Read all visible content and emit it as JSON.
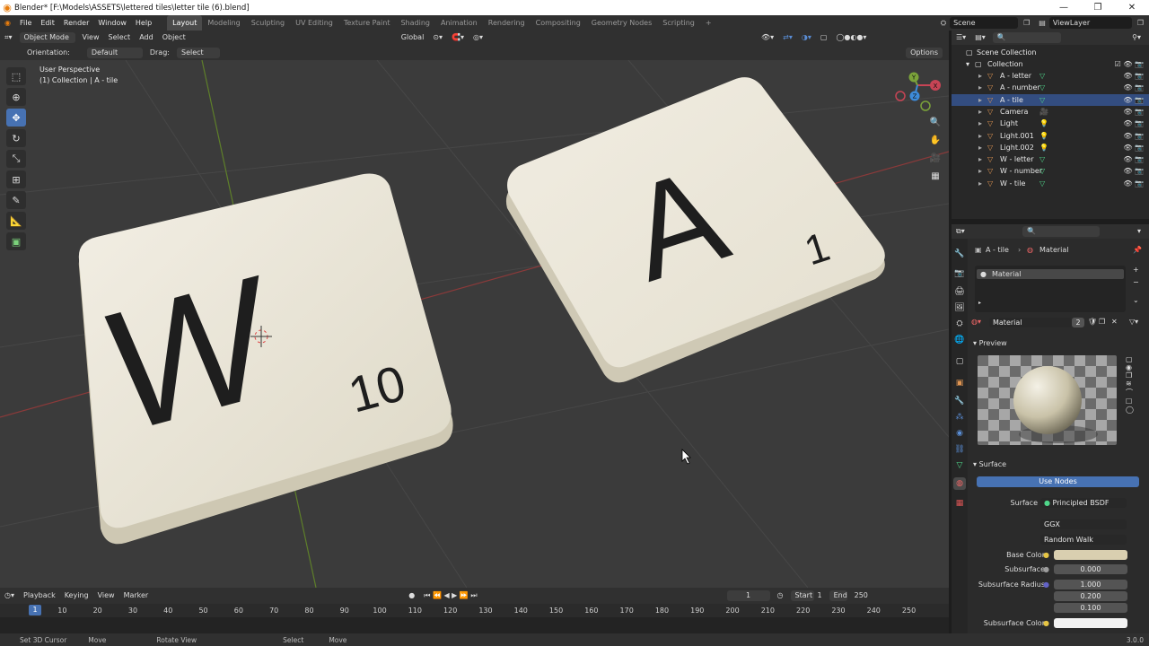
{
  "window": {
    "title": "Blender* [F:\\Models\\ASSETS\\lettered tiles\\letter tile (6).blend]",
    "controls": [
      "—",
      "❐",
      "✕"
    ]
  },
  "menubar": {
    "menus": [
      "File",
      "Edit",
      "Render",
      "Window",
      "Help"
    ],
    "workspaces": [
      "Layout",
      "Modeling",
      "Sculpting",
      "UV Editing",
      "Texture Paint",
      "Shading",
      "Animation",
      "Rendering",
      "Compositing",
      "Geometry Nodes",
      "Scripting"
    ],
    "active_workspace": "Layout",
    "add_tab": "+",
    "scene": "Scene",
    "view_layer": "ViewLayer"
  },
  "viewport_header": {
    "mode": "Object Mode",
    "menus": [
      "View",
      "Select",
      "Add",
      "Object"
    ],
    "transform": "Global"
  },
  "tool_header": {
    "orientation_label": "Orientation:",
    "orientation": "Default",
    "drag_label": "Drag:",
    "drag": "Select Box",
    "options": "Options"
  },
  "viewport": {
    "perspective": "User Perspective",
    "collection": "(1) Collection | A - tile",
    "tile_w": {
      "letter": "W",
      "number": "10"
    },
    "tile_a": {
      "letter": "A",
      "number": "1"
    },
    "gizmo": {
      "x": "X",
      "y": "Y",
      "z": "Z"
    }
  },
  "toolbar": {
    "tools": [
      "select-box-icon",
      "cursor-icon",
      "move-icon",
      "rotate-icon",
      "scale-icon",
      "transform-icon",
      "annotate-icon",
      "measure-icon",
      "add-cube-icon"
    ],
    "active": "move-icon"
  },
  "timeline": {
    "menus": [
      "Playback",
      "Keying",
      "View",
      "Marker"
    ],
    "current_frame": "1",
    "start_label": "Start",
    "start": "1",
    "end_label": "End",
    "end": "250",
    "ticks": [
      "10",
      "20",
      "30",
      "40",
      "50",
      "60",
      "70",
      "80",
      "90",
      "100",
      "110",
      "120",
      "130",
      "140",
      "150",
      "160",
      "170",
      "180",
      "190",
      "200",
      "210",
      "220",
      "230",
      "240",
      "250"
    ]
  },
  "statusbar": {
    "items": [
      "Set 3D Cursor",
      "Move",
      "Rotate View",
      "Select",
      "Move"
    ],
    "version": "3.0.0"
  },
  "outliner": {
    "root": "Scene Collection",
    "collection": "Collection",
    "items": [
      {
        "name": "A - letter",
        "kind": "mesh",
        "icon_color": "#e09552",
        "data_color": "#4fd68a",
        "selected": false
      },
      {
        "name": "A - number",
        "kind": "mesh",
        "icon_color": "#e09552",
        "data_color": "#4fd68a",
        "selected": false
      },
      {
        "name": "A - tile",
        "kind": "mesh",
        "icon_color": "#e09552",
        "data_color": "#4fd68a",
        "selected": true
      },
      {
        "name": "Camera",
        "kind": "camera",
        "icon_color": "#e09552",
        "data_color": "#4fd68a",
        "selected": false
      },
      {
        "name": "Light",
        "kind": "light",
        "icon_color": "#e09552",
        "data_color": "#4fd68a",
        "selected": false
      },
      {
        "name": "Light.001",
        "kind": "light",
        "icon_color": "#e09552",
        "data_color": "#4fd68a",
        "selected": false
      },
      {
        "name": "Light.002",
        "kind": "light",
        "icon_color": "#e09552",
        "data_color": "#4fd68a",
        "selected": false
      },
      {
        "name": "W - letter",
        "kind": "mesh",
        "icon_color": "#e09552",
        "data_color": "#4fd68a",
        "selected": false
      },
      {
        "name": "W - number",
        "kind": "mesh",
        "icon_color": "#e09552",
        "data_color": "#4fd68a",
        "selected": false
      },
      {
        "name": "W - tile",
        "kind": "mesh",
        "icon_color": "#e09552",
        "data_color": "#4fd68a",
        "selected": false
      }
    ]
  },
  "properties": {
    "breadcrumb": {
      "object": "A - tile",
      "data": "Material"
    },
    "slot": "Material",
    "material_name": "Material",
    "users": "2",
    "preview_label": "Preview",
    "surface_label": "Surface",
    "use_nodes": "Use Nodes",
    "surface_field_label": "Surface",
    "surface_shader": "Principled BSDF",
    "distribution": "GGX",
    "subsurface_method": "Random Walk",
    "base_color_label": "Base Color",
    "base_color": "#d9cfb0",
    "subsurface_label": "Subsurface",
    "subsurface": "0.000",
    "subsurface_radius_label": "Subsurface Radius",
    "subsurface_radius": [
      "1.000",
      "0.200",
      "0.100"
    ],
    "subsurface_color_label": "Subsurface Color",
    "subsurface_color": "#f2f2f2"
  },
  "colors": {
    "accent": "#4772b3",
    "x_axis": "#c74455",
    "y_axis": "#7ba33a",
    "z_axis": "#3d8bd9"
  }
}
